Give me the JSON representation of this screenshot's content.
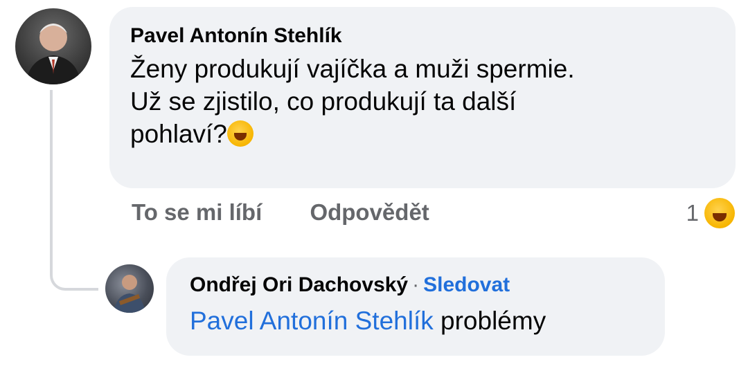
{
  "comment": {
    "author": "Pavel Antonín Stehlík",
    "text": "Ženy produkují vajíčka a muži spermie.\nUž se zjistilo, co produkují ta další\npohlaví?",
    "emoji": "rolling-on-floor-laughing-emoji",
    "actions": {
      "like": "To se mi líbí",
      "reply": "Odpovědět"
    },
    "reaction_count": "1",
    "reaction_emoji": "laughing-emoji"
  },
  "reply": {
    "author": "Ondřej Ori Dachovský",
    "separator": "·",
    "follow": "Sledovat",
    "mention": "Pavel Antonín Stehlík",
    "text": "problémy"
  }
}
